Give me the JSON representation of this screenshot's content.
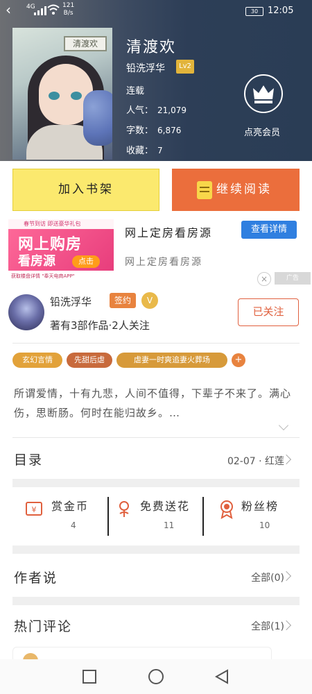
{
  "status_bar": {
    "network": "4G",
    "speed_value": "121",
    "speed_unit": "B/s",
    "battery": "30",
    "time": "12:05"
  },
  "book": {
    "cover_sign": "清渡欢",
    "title": "清渡欢",
    "author": "铅洗浮华",
    "level_badge": "Lv2",
    "status": "连载",
    "popularity_label": "人气：",
    "popularity": "21,079",
    "word_count_label": "字数：",
    "word_count": "6,876",
    "favorites_label": "收藏：",
    "favorites": "7"
  },
  "vip": {
    "label": "点亮会员"
  },
  "actions": {
    "add_shelf": "加入书架",
    "continue_read": "继续阅读"
  },
  "ad": {
    "image_top": "春节到访 即送豪华礼包",
    "image_big1": "网上购房",
    "image_big2": "看房源",
    "image_click": "点击",
    "image_bottom": "获取楼盘详情  \"奉天电商APP\"",
    "title": "网上定房看房源",
    "button": "查看详情",
    "subtitle": "网上定房看房源",
    "close": "×",
    "tag": "广告"
  },
  "author": {
    "name": "铅洗浮华",
    "sign_badge": "签约",
    "v_badge": "V",
    "works": "著有3部作品·2人关注",
    "follow_button": "已关注"
  },
  "tags": [
    {
      "label": "玄幻言情",
      "color": "#e2a23a"
    },
    {
      "label": "先甜后虐",
      "color": "#c86a3c"
    },
    {
      "label": "虐妻一时爽追妻火葬场",
      "color": "#d79a3a"
    }
  ],
  "tag_more": "+",
  "synopsis": "所谓爱情，十有九悲，人间不值得，下辈子不来了。满心伤，思断肠。何时在能归故乡。…",
  "toc": {
    "title": "目录",
    "latest": "02-07 · 红莲"
  },
  "rewards": [
    {
      "label": "赏金币",
      "count": "4"
    },
    {
      "label": "免费送花",
      "count": "11"
    },
    {
      "label": "粉丝榜",
      "count": "10"
    }
  ],
  "author_says": {
    "title": "作者说",
    "right": "全部(0)"
  },
  "hot_comments": {
    "title": "热门评论",
    "right": "全部(1)"
  },
  "colors": {
    "accent_orange": "#eb6e3c",
    "shelf_yellow": "#fbe96e",
    "ad_blue": "#2f7fe0"
  },
  "icons": [
    "back-arrow-icon",
    "signal-icon",
    "wifi-icon",
    "battery-icon",
    "crown-icon",
    "book-icon",
    "coin-icon",
    "flower-icon",
    "medal-icon",
    "chevron-right-icon",
    "square-nav-icon",
    "home-circle-icon",
    "back-triangle-icon"
  ]
}
